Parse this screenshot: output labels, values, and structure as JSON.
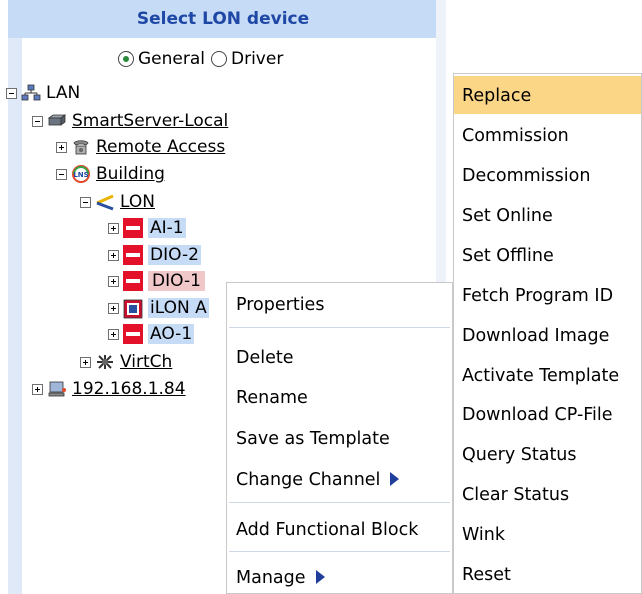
{
  "panel": {
    "title": "Select LON device",
    "mode": {
      "options": [
        "General",
        "Driver"
      ],
      "selected": "General"
    }
  },
  "tree": [
    {
      "id": "lan",
      "label": "LAN",
      "icon": "network-icon",
      "expanded": true,
      "underline": false
    },
    {
      "id": "smartserver",
      "label": "SmartServer-Local",
      "icon": "server-icon",
      "expanded": true
    },
    {
      "id": "remote",
      "label": "Remote Access",
      "icon": "phone-icon",
      "expanded": false
    },
    {
      "id": "building",
      "label": "Building",
      "icon": "building-logo-icon",
      "expanded": true
    },
    {
      "id": "lon",
      "label": "LON",
      "icon": "lon-channel-icon",
      "expanded": true
    },
    {
      "id": "ai1",
      "label": "AI-1",
      "icon": "device-red-icon",
      "expanded": false
    },
    {
      "id": "dio2",
      "label": "DIO-2",
      "icon": "device-red-icon",
      "expanded": false
    },
    {
      "id": "dio1",
      "label": "DIO-1",
      "icon": "device-red-icon",
      "expanded": false
    },
    {
      "id": "ilon",
      "label": "iLON A",
      "icon": "ilon-device-icon",
      "expanded": false
    },
    {
      "id": "ao1",
      "label": "AO-1",
      "icon": "device-red-icon",
      "expanded": false
    },
    {
      "id": "virtch",
      "label": "VirtCh",
      "icon": "virtual-channel-icon",
      "expanded": false
    },
    {
      "id": "ip",
      "label": "192.168.1.84",
      "icon": "computer-icon",
      "expanded": false
    }
  ],
  "context_menu": {
    "items": [
      "Properties",
      "Delete",
      "Rename",
      "Save as Template",
      "Change Channel",
      "Add Functional Block",
      "Manage"
    ]
  },
  "submenu": {
    "highlighted": "Replace",
    "items": [
      "Replace",
      "Commission",
      "Decommission",
      "Set Online",
      "Set Offline",
      "Fetch Program ID",
      "Download Image",
      "Activate Template",
      "Download CP-File",
      "Query Status",
      "Clear Status",
      "Wink",
      "Reset"
    ]
  },
  "colors": {
    "header_bg": "#c6dbf5",
    "header_text": "#1f47a6",
    "menu_highlight": "#fbd687",
    "device_red": "#e3112a"
  }
}
